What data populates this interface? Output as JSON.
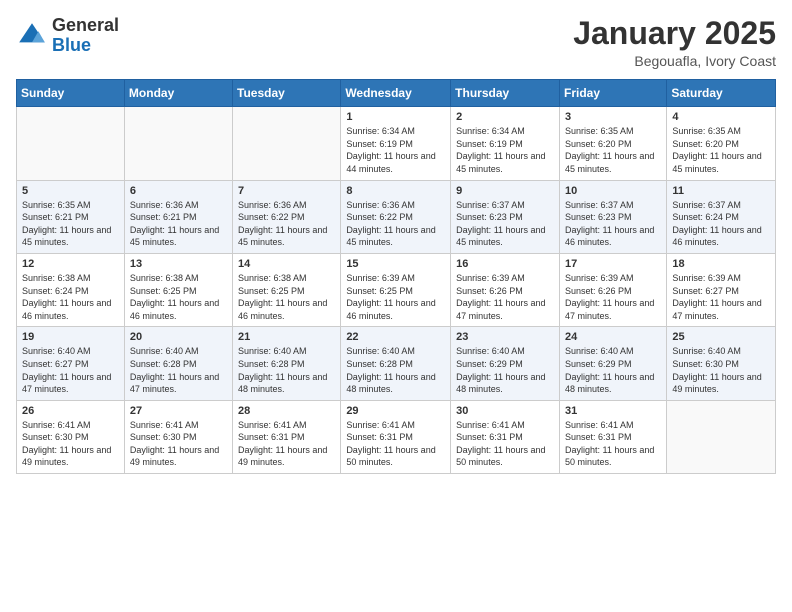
{
  "header": {
    "logo_line1": "General",
    "logo_line2": "Blue",
    "title": "January 2025",
    "subtitle": "Begouafla, Ivory Coast"
  },
  "days_of_week": [
    "Sunday",
    "Monday",
    "Tuesday",
    "Wednesday",
    "Thursday",
    "Friday",
    "Saturday"
  ],
  "weeks": [
    [
      {
        "day": "",
        "info": ""
      },
      {
        "day": "",
        "info": ""
      },
      {
        "day": "",
        "info": ""
      },
      {
        "day": "1",
        "info": "Sunrise: 6:34 AM\nSunset: 6:19 PM\nDaylight: 11 hours and 44 minutes."
      },
      {
        "day": "2",
        "info": "Sunrise: 6:34 AM\nSunset: 6:19 PM\nDaylight: 11 hours and 45 minutes."
      },
      {
        "day": "3",
        "info": "Sunrise: 6:35 AM\nSunset: 6:20 PM\nDaylight: 11 hours and 45 minutes."
      },
      {
        "day": "4",
        "info": "Sunrise: 6:35 AM\nSunset: 6:20 PM\nDaylight: 11 hours and 45 minutes."
      }
    ],
    [
      {
        "day": "5",
        "info": "Sunrise: 6:35 AM\nSunset: 6:21 PM\nDaylight: 11 hours and 45 minutes."
      },
      {
        "day": "6",
        "info": "Sunrise: 6:36 AM\nSunset: 6:21 PM\nDaylight: 11 hours and 45 minutes."
      },
      {
        "day": "7",
        "info": "Sunrise: 6:36 AM\nSunset: 6:22 PM\nDaylight: 11 hours and 45 minutes."
      },
      {
        "day": "8",
        "info": "Sunrise: 6:36 AM\nSunset: 6:22 PM\nDaylight: 11 hours and 45 minutes."
      },
      {
        "day": "9",
        "info": "Sunrise: 6:37 AM\nSunset: 6:23 PM\nDaylight: 11 hours and 45 minutes."
      },
      {
        "day": "10",
        "info": "Sunrise: 6:37 AM\nSunset: 6:23 PM\nDaylight: 11 hours and 46 minutes."
      },
      {
        "day": "11",
        "info": "Sunrise: 6:37 AM\nSunset: 6:24 PM\nDaylight: 11 hours and 46 minutes."
      }
    ],
    [
      {
        "day": "12",
        "info": "Sunrise: 6:38 AM\nSunset: 6:24 PM\nDaylight: 11 hours and 46 minutes."
      },
      {
        "day": "13",
        "info": "Sunrise: 6:38 AM\nSunset: 6:25 PM\nDaylight: 11 hours and 46 minutes."
      },
      {
        "day": "14",
        "info": "Sunrise: 6:38 AM\nSunset: 6:25 PM\nDaylight: 11 hours and 46 minutes."
      },
      {
        "day": "15",
        "info": "Sunrise: 6:39 AM\nSunset: 6:25 PM\nDaylight: 11 hours and 46 minutes."
      },
      {
        "day": "16",
        "info": "Sunrise: 6:39 AM\nSunset: 6:26 PM\nDaylight: 11 hours and 47 minutes."
      },
      {
        "day": "17",
        "info": "Sunrise: 6:39 AM\nSunset: 6:26 PM\nDaylight: 11 hours and 47 minutes."
      },
      {
        "day": "18",
        "info": "Sunrise: 6:39 AM\nSunset: 6:27 PM\nDaylight: 11 hours and 47 minutes."
      }
    ],
    [
      {
        "day": "19",
        "info": "Sunrise: 6:40 AM\nSunset: 6:27 PM\nDaylight: 11 hours and 47 minutes."
      },
      {
        "day": "20",
        "info": "Sunrise: 6:40 AM\nSunset: 6:28 PM\nDaylight: 11 hours and 47 minutes."
      },
      {
        "day": "21",
        "info": "Sunrise: 6:40 AM\nSunset: 6:28 PM\nDaylight: 11 hours and 48 minutes."
      },
      {
        "day": "22",
        "info": "Sunrise: 6:40 AM\nSunset: 6:28 PM\nDaylight: 11 hours and 48 minutes."
      },
      {
        "day": "23",
        "info": "Sunrise: 6:40 AM\nSunset: 6:29 PM\nDaylight: 11 hours and 48 minutes."
      },
      {
        "day": "24",
        "info": "Sunrise: 6:40 AM\nSunset: 6:29 PM\nDaylight: 11 hours and 48 minutes."
      },
      {
        "day": "25",
        "info": "Sunrise: 6:40 AM\nSunset: 6:30 PM\nDaylight: 11 hours and 49 minutes."
      }
    ],
    [
      {
        "day": "26",
        "info": "Sunrise: 6:41 AM\nSunset: 6:30 PM\nDaylight: 11 hours and 49 minutes."
      },
      {
        "day": "27",
        "info": "Sunrise: 6:41 AM\nSunset: 6:30 PM\nDaylight: 11 hours and 49 minutes."
      },
      {
        "day": "28",
        "info": "Sunrise: 6:41 AM\nSunset: 6:31 PM\nDaylight: 11 hours and 49 minutes."
      },
      {
        "day": "29",
        "info": "Sunrise: 6:41 AM\nSunset: 6:31 PM\nDaylight: 11 hours and 50 minutes."
      },
      {
        "day": "30",
        "info": "Sunrise: 6:41 AM\nSunset: 6:31 PM\nDaylight: 11 hours and 50 minutes."
      },
      {
        "day": "31",
        "info": "Sunrise: 6:41 AM\nSunset: 6:31 PM\nDaylight: 11 hours and 50 minutes."
      },
      {
        "day": "",
        "info": ""
      }
    ]
  ]
}
